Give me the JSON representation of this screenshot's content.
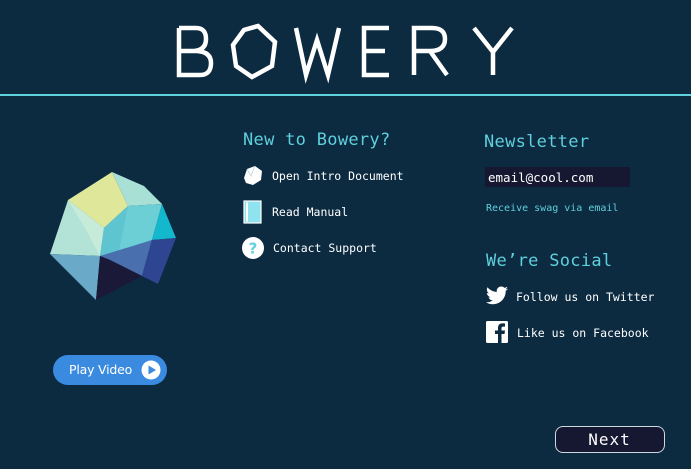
{
  "header": {
    "logo_text": "BOWERY"
  },
  "video": {
    "play_label": "Play Video",
    "play_icon": "play-icon"
  },
  "new_section": {
    "title": "New to Bowery?",
    "links": [
      {
        "label": "Open Intro Document",
        "icon": "document-gem-icon"
      },
      {
        "label": "Read Manual",
        "icon": "book-icon"
      },
      {
        "label": "Contact Support",
        "icon": "question-mark-icon"
      }
    ]
  },
  "newsletter": {
    "title": "Newsletter",
    "email_value": "email@cool.com",
    "swag_text": "Receive swag via email"
  },
  "social": {
    "title": "We’re Social",
    "links": [
      {
        "label": "Follow us on Twitter",
        "icon": "twitter-icon"
      },
      {
        "label": "Like us on Facebook",
        "icon": "facebook-icon"
      }
    ]
  },
  "footer": {
    "next_label": "Next"
  },
  "colors": {
    "background": "#0c2a40",
    "accent": "#5fd0dd",
    "button_blue": "#3a8be0",
    "input_bg": "#161831"
  }
}
